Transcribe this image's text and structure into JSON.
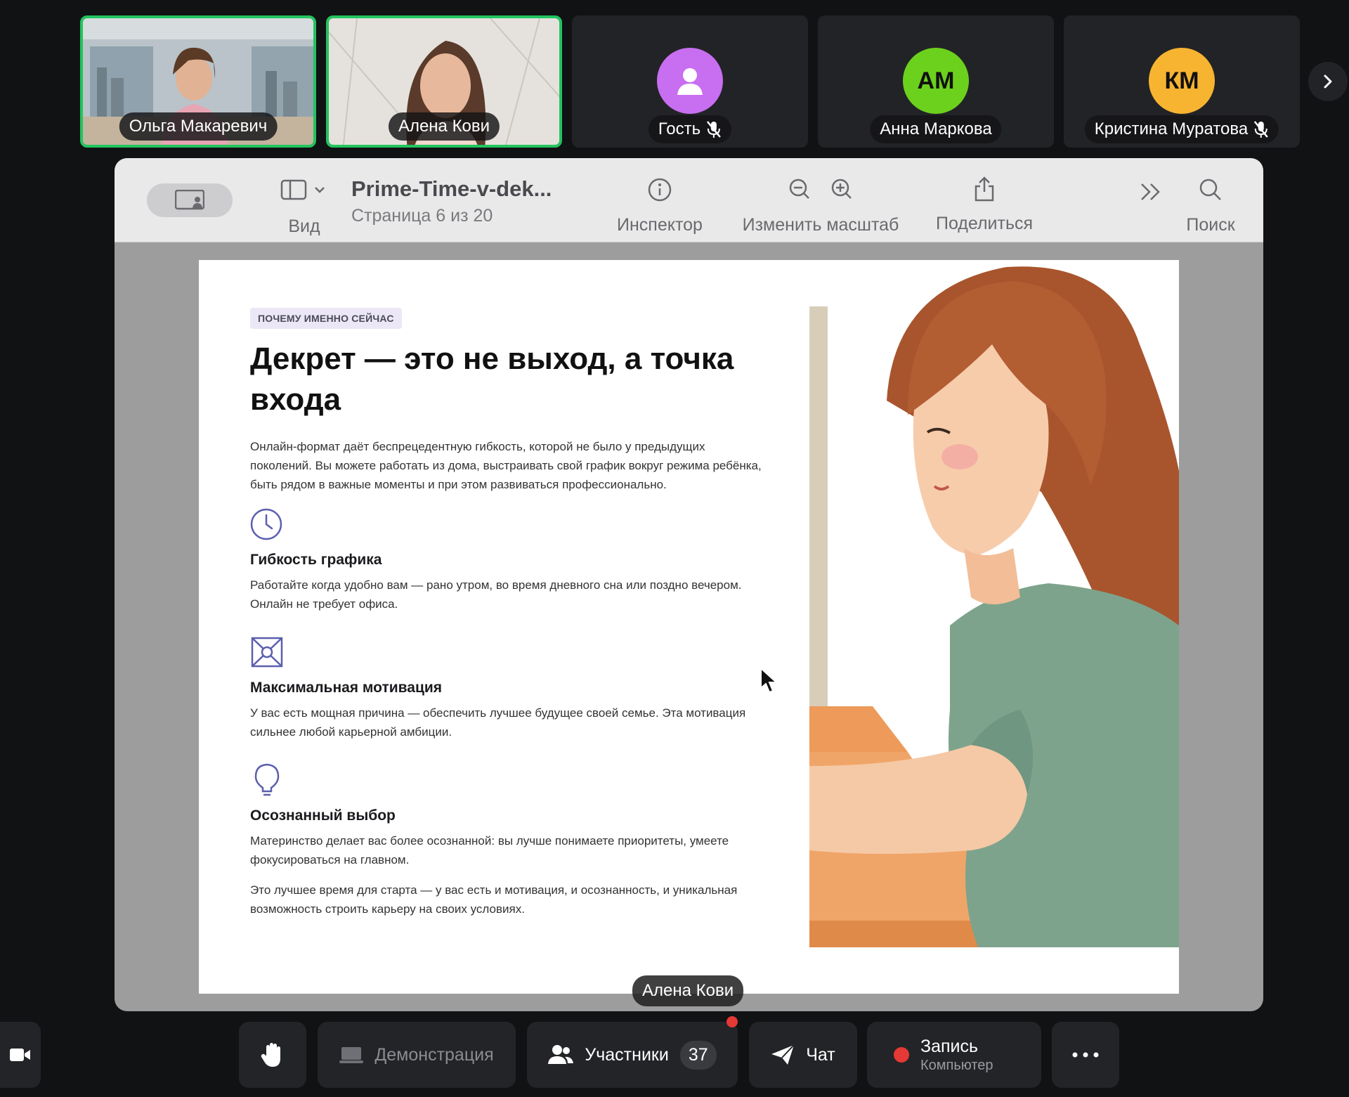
{
  "participants": [
    {
      "name": "Ольга Макаревич",
      "active": true,
      "video": true
    },
    {
      "name": "Алена Кови",
      "active": true,
      "video": true
    },
    {
      "name": "Гость",
      "initials": "",
      "avatar_color": "#c86ef0",
      "muted": true
    },
    {
      "name": "Анна Маркова",
      "initials": "АМ",
      "avatar_color": "#6cd11d",
      "muted": false
    },
    {
      "name": "Кристина Муратова",
      "initials": "КМ",
      "avatar_color": "#f7b431",
      "muted": true
    }
  ],
  "viewer": {
    "doc_title": "Prime-Time-v-dek...",
    "page_info": "Страница 6 из 20",
    "toolbar": {
      "view": "Вид",
      "inspector": "Инспектор",
      "zoom": "Изменить масштаб",
      "share": "Поделиться",
      "search": "Поиск"
    }
  },
  "slide": {
    "tag": "ПОЧЕМУ ИМЕННО СЕЙЧАС",
    "headline": "Декрет — это не выход, а точка входа",
    "intro": "Онлайн-формат даёт беспрецедентную гибкость, которой не было у предыдущих поколений. Вы можете работать из дома, выстраивать свой график вокруг режима ребёнка, быть рядом в важные моменты и при этом развиваться профессионально.",
    "features": [
      {
        "icon": "clock-icon",
        "title": "Гибкость графика",
        "text": "Работайте когда удобно вам — рано утром, во время дневного сна или поздно вечером. Онлайн не требует офиса."
      },
      {
        "icon": "target-icon",
        "title": "Максимальная мотивация",
        "text": "У вас есть мощная причина — обеспечить лучшее будущее своей семье. Эта мотивация сильнее любой карьерной амбиции."
      },
      {
        "icon": "lightbulb-icon",
        "title": "Осознанный выбор",
        "text": "Материнство делает вас более осознанной: вы лучше понимаете приоритеты, умеете фокусироваться на главном."
      }
    ],
    "closing": "Это лучшее время для старта — у вас есть и мотивация, и осознанность, и уникальная возможность строить карьеру на своих условиях."
  },
  "speaker_label": "Алена Кови",
  "controls": {
    "demo": "Демонстрация",
    "participants_label": "Участники",
    "participants_count": "37",
    "chat": "Чат",
    "record": "Запись",
    "record_sub": "Компьютер"
  },
  "colors": {
    "active_border": "#22c45e",
    "record_dot": "#e53935",
    "tag_bg": "#ebe7f7"
  }
}
